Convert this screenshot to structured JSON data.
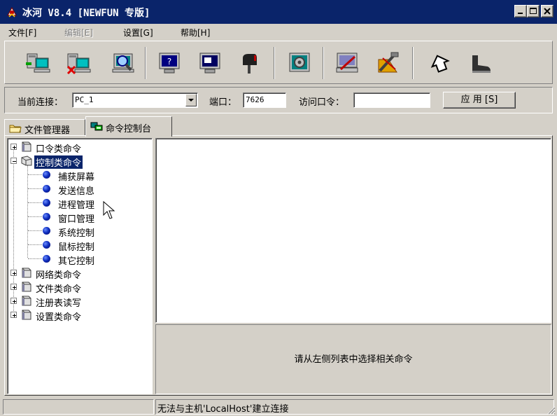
{
  "window": {
    "title": "冰河 V8.4 [NEWFUN 专版]"
  },
  "menu": [
    {
      "label": "文件[F]",
      "enabled": true
    },
    {
      "label": "编辑[E]",
      "enabled": false
    },
    {
      "label": "设置[G]",
      "enabled": true
    },
    {
      "label": "帮助[H]",
      "enabled": true
    }
  ],
  "toolbar": {
    "icons": [
      "add-host-icon",
      "delete-host-icon",
      "search-host-icon",
      "screen-capture-icon",
      "screen-control-icon",
      "mailbox-icon",
      "settings-icon",
      "server-config-icon",
      "tools-icon",
      "help-icon",
      "exit-icon"
    ]
  },
  "connection": {
    "host_label": "当前连接：",
    "host_value": "PC_1",
    "port_label": "端口：",
    "port_value": "7626",
    "password_label": "访问口令：",
    "password_value": "",
    "apply_label": "应 用 [S]"
  },
  "tabs": [
    {
      "label": "文件管理器",
      "active": false
    },
    {
      "label": "命令控制台",
      "active": true
    }
  ],
  "tree": {
    "groups": [
      {
        "label": "口令类命令",
        "expanded": false
      },
      {
        "label": "控制类命令",
        "expanded": true,
        "selected": true,
        "children": [
          "捕获屏幕",
          "发送信息",
          "进程管理",
          "窗口管理",
          "系统控制",
          "鼠标控制",
          "其它控制"
        ]
      },
      {
        "label": "网络类命令",
        "expanded": false
      },
      {
        "label": "文件类命令",
        "expanded": false
      },
      {
        "label": "注册表读写",
        "expanded": false
      },
      {
        "label": "设置类命令",
        "expanded": false
      }
    ]
  },
  "hint": "请从左侧列表中选择相关命令",
  "status": {
    "message": "无法与主机'LocalHost'建立连接"
  },
  "colors": {
    "titlebar": "#0a246a",
    "face": "#d4d0c8",
    "selection": "#0a246a"
  }
}
